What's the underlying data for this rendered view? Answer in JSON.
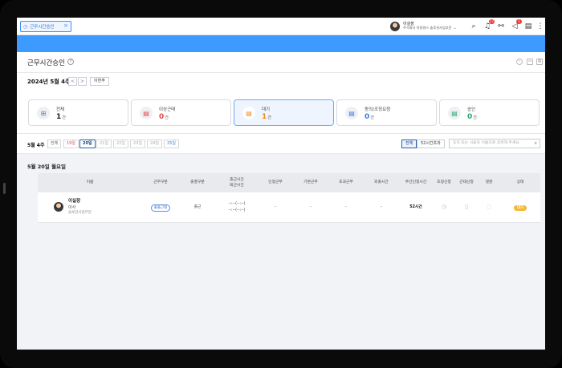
{
  "tab": {
    "label": "근무시간승인",
    "icon": "clock-icon"
  },
  "user": {
    "name": "이실장",
    "org": "주식회사 아랑센스 솔루션사업부문"
  },
  "header_icons": [
    {
      "name": "search-icon",
      "glyph": "⌕"
    },
    {
      "name": "bell-icon",
      "glyph": "🔔",
      "badge": "17"
    },
    {
      "name": "org-chart-icon",
      "glyph": "⚯"
    },
    {
      "name": "megaphone-icon",
      "glyph": "📣",
      "badge": "1"
    },
    {
      "name": "document-icon",
      "glyph": "▤"
    },
    {
      "name": "more-icon",
      "glyph": "⋮"
    }
  ],
  "page": {
    "title": "근무시간승인"
  },
  "week": {
    "label": "2024년 5월 4주",
    "prev": "<",
    "next": ">",
    "this_week": "이번주"
  },
  "cards": [
    {
      "label": "전체",
      "count": "1",
      "unit": "건",
      "icon": "grid-icon",
      "color": "#333333"
    },
    {
      "label": "이상근태",
      "count": "0",
      "unit": "건",
      "icon": "document-error-icon",
      "color": "#e34848"
    },
    {
      "label": "대기",
      "count": "1",
      "unit": "건",
      "icon": "document-pending-icon",
      "color": "#f08a24"
    },
    {
      "label": "동의/조정요청",
      "count": "0",
      "unit": "건",
      "icon": "document-request-icon",
      "color": "#3a7ee0"
    },
    {
      "label": "승인",
      "count": "0",
      "unit": "건",
      "icon": "document-approved-icon",
      "color": "#23a86b"
    }
  ],
  "filter": {
    "week_label": "5월 4주",
    "days": [
      "전체",
      "19일",
      "20일",
      "21일",
      "22일",
      "23일",
      "24일",
      "25일"
    ],
    "selected_day": "20일",
    "view_all": "전체",
    "view_52": "52시간초과",
    "search_placeholder": "조직 또는 사용자 이름으로 검색해 주세요."
  },
  "date_heading": "5월 20일 월요일",
  "table": {
    "headers": [
      "이름",
      "근무구분",
      "출결구분",
      "출근시간\n퇴근시간",
      "인정근무",
      "기본근무",
      "초과근무",
      "외출시간",
      "주간인정시간",
      "조정신청",
      "근태신청",
      "댓글",
      "상태"
    ],
    "row": {
      "name": "이실장",
      "title": "이사",
      "dept": "솔루션사업부문",
      "work_type": "출출근태",
      "attendance": "출근",
      "clock_in": "--:--(--:--)",
      "clock_out": "--:--(--:--)",
      "recognized": "-",
      "basic": "-",
      "overtime": "-",
      "outing": "-",
      "weekly": "52시간",
      "status": "대기"
    }
  }
}
